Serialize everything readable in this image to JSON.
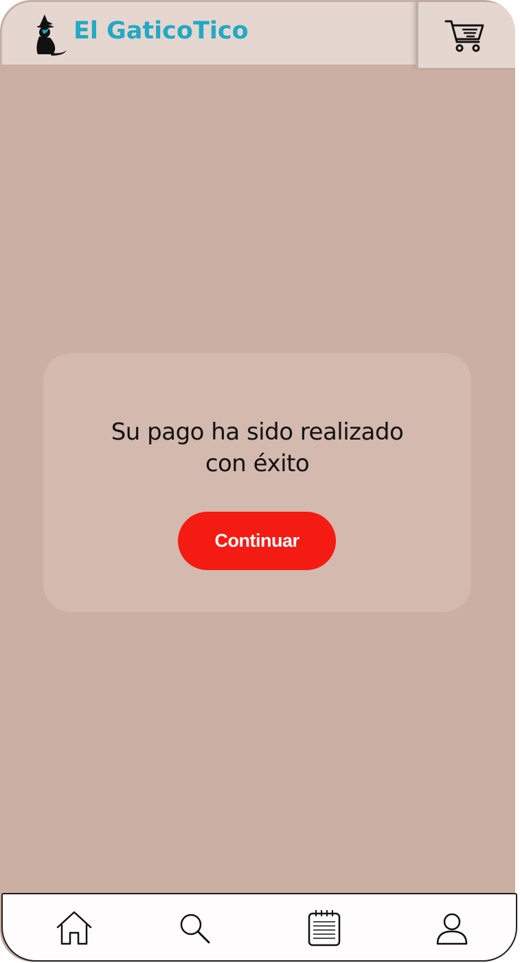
{
  "app": {
    "brand_name": "El GaticoTico"
  },
  "header": {
    "logo_icon": "cat-logo-icon",
    "cart_icon": "shopping-cart-icon"
  },
  "dialog": {
    "message_line1": "Su pago ha sido realizado",
    "message_line2": "con éxito",
    "continue_label": "Continuar"
  },
  "bottom_nav": {
    "items": [
      {
        "id": "home",
        "icon": "home-icon"
      },
      {
        "id": "search",
        "icon": "search-icon"
      },
      {
        "id": "orders",
        "icon": "notepad-icon"
      },
      {
        "id": "profile",
        "icon": "user-icon"
      }
    ]
  },
  "colors": {
    "background": "#cbafa2",
    "header": "#e5d6d0",
    "card": "#d3b9ae",
    "accent_button": "#f41b13",
    "brand_text": "#23a9c4"
  }
}
